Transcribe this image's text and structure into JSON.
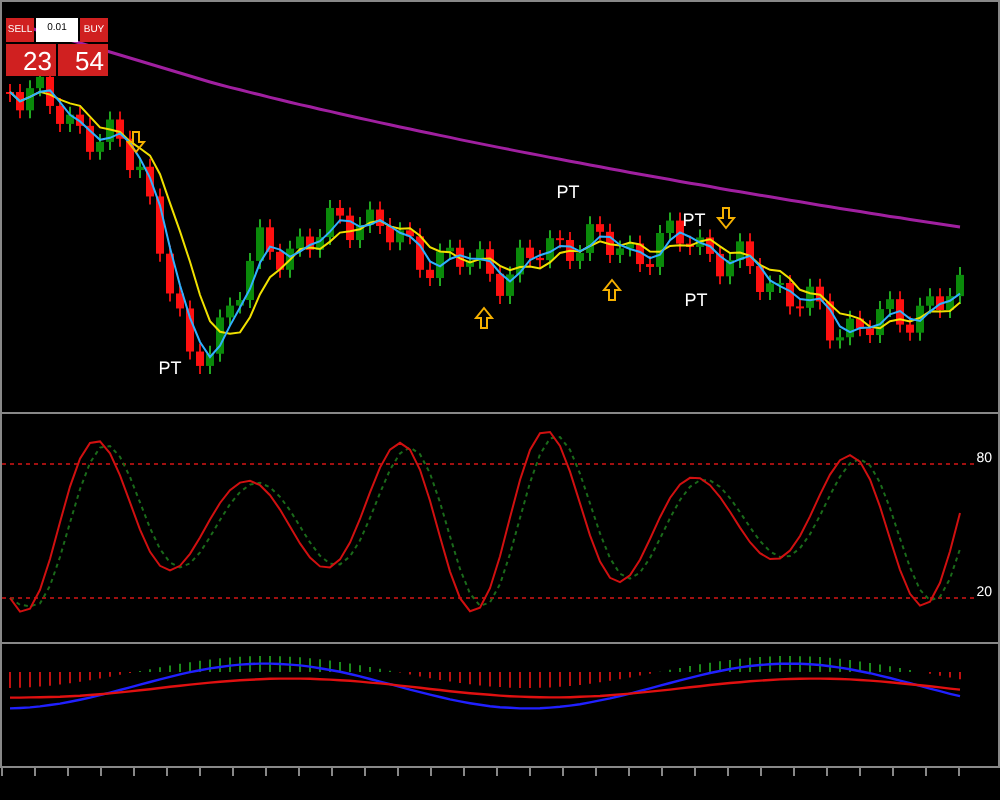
{
  "trade_panel": {
    "sell": "SELL",
    "buy": "BUY",
    "lot": "0.01",
    "sell_price": "23",
    "buy_price": "54"
  },
  "chart": {
    "markers": [
      {
        "kind": "arrow_down"
      },
      {
        "kind": "pt",
        "text": "PT"
      },
      {
        "kind": "arrow_up"
      },
      {
        "kind": "pt",
        "text": "PT"
      },
      {
        "kind": "arrow_up"
      },
      {
        "kind": "pt",
        "text": "PT"
      },
      {
        "kind": "arrow_down"
      },
      {
        "kind": "pt",
        "text": "PT"
      }
    ]
  },
  "oscillator": {
    "levels": [
      "80",
      "20"
    ]
  }
}
